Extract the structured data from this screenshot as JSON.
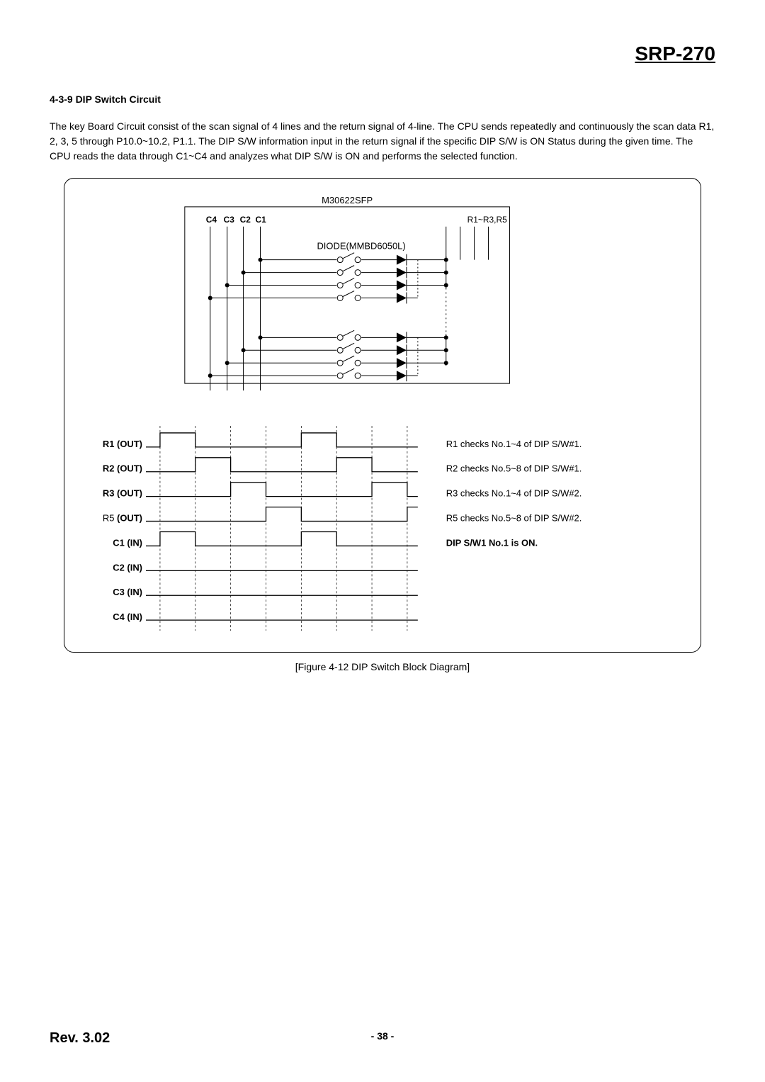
{
  "header": {
    "title": "SRP-270"
  },
  "section": {
    "number_title": "4-3-9 DIP Switch Circuit",
    "paragraph": "The key Board Circuit consist of the scan signal of 4 lines and the return signal of 4-line. The CPU sends repeatedly and continuously the scan data R1, 2, 3, 5 through P10.0~10.2, P1.1. The DIP S/W information input in the return signal if the specific DIP S/W is ON Status during the given time. The CPU reads the data through C1~C4 and analyzes what DIP S/W is ON and performs the selected function."
  },
  "diagram": {
    "chip_label": "M30622SFP",
    "diode_label": "DIODE(MMBD6050L)",
    "left_bus_labels": [
      "C4",
      "C3",
      "C2",
      "C1"
    ],
    "right_bus_label": "R1~R3,R5",
    "timing_rows": [
      "R1 (OUT)",
      "R2 (OUT)",
      "R3 (OUT)",
      "R5 (OUT)",
      "C1 (IN)",
      "C2 (IN)",
      "C3 (IN)",
      "C4 (IN)"
    ],
    "timing_notes": [
      "R1 checks No.1~4 of DIP S/W#1.",
      "R2 checks No.5~8 of DIP S/W#1.",
      "R3 checks No.1~4 of DIP S/W#2.",
      "R5 checks No.5~8 of DIP S/W#2."
    ],
    "timing_status": "DIP S/W1 No.1 is ON.",
    "caption": "[Figure 4-12 DIP Switch Block Diagram]"
  },
  "footer": {
    "revision": "Rev. 3.02",
    "page": "- 38 -"
  },
  "chart_data": {
    "type": "table",
    "title": "DIP Switch scan/return schematic + timing diagram",
    "block_diagram": {
      "scan_lines_out": [
        "R1",
        "R2",
        "R3",
        "R5"
      ],
      "return_lines_in": [
        "C1",
        "C2",
        "C3",
        "C4"
      ],
      "mcu": "M30622SFP",
      "diode_type": "MMBD6050L",
      "switch_banks": 2,
      "switches_per_bank": 8,
      "resistors": "R1~R3,R5"
    },
    "timing": {
      "time_slots": 8,
      "signals": [
        {
          "name": "R1 (OUT)",
          "high_slots": [
            0,
            4
          ],
          "note": "R1 checks No.1~4 of DIP S/W#1."
        },
        {
          "name": "R2 (OUT)",
          "high_slots": [
            1,
            5
          ],
          "note": "R2 checks No.5~8 of DIP S/W#1."
        },
        {
          "name": "R3 (OUT)",
          "high_slots": [
            2,
            6
          ],
          "note": "R3 checks No.1~4 of DIP S/W#2."
        },
        {
          "name": "R5 (OUT)",
          "high_slots": [
            3,
            7
          ],
          "note": "R5 checks No.5~8 of DIP S/W#2."
        },
        {
          "name": "C1 (IN)",
          "high_slots": [
            0,
            4
          ],
          "note": "DIP S/W1 No.1 is ON."
        },
        {
          "name": "C2 (IN)",
          "high_slots": []
        },
        {
          "name": "C3 (IN)",
          "high_slots": []
        },
        {
          "name": "C4 (IN)",
          "high_slots": []
        }
      ]
    }
  }
}
